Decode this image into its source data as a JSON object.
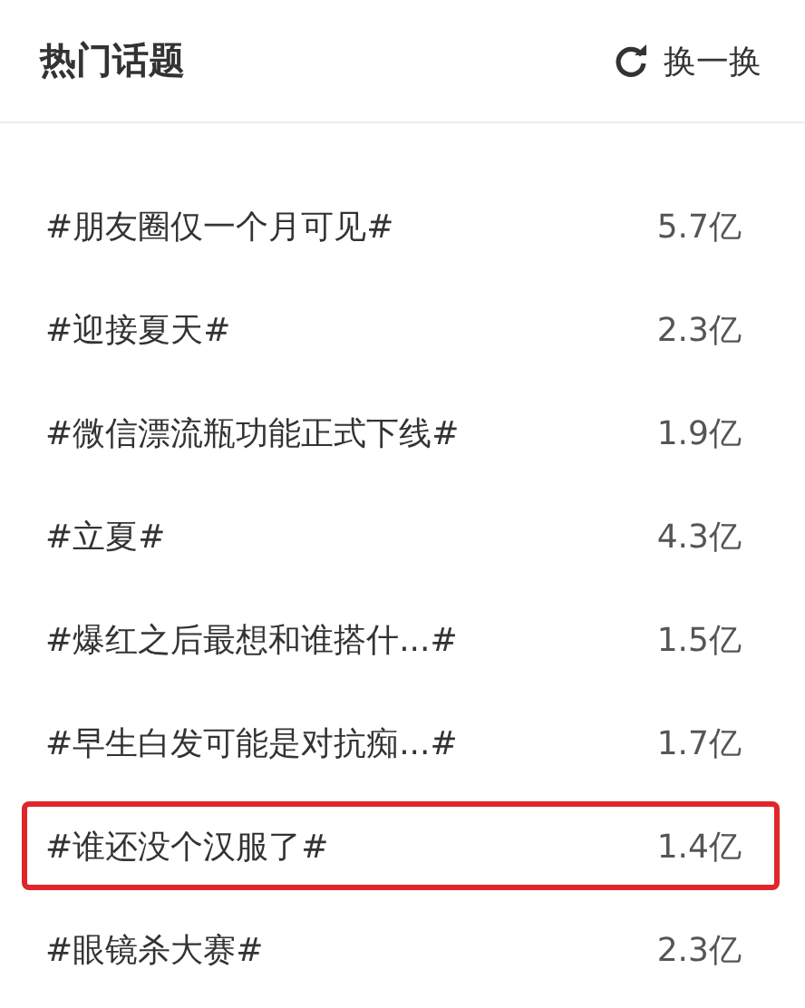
{
  "header": {
    "title": "热门话题",
    "refresh_label": "换一换"
  },
  "topics": [
    {
      "title": "#朋友圈仅一个月可见#",
      "count": "5.7亿",
      "highlighted": false
    },
    {
      "title": "#迎接夏天#",
      "count": "2.3亿",
      "highlighted": false
    },
    {
      "title": "#微信漂流瓶功能正式下线#",
      "count": "1.9亿",
      "highlighted": false
    },
    {
      "title": "#立夏#",
      "count": "4.3亿",
      "highlighted": false
    },
    {
      "title": "#爆红之后最想和谁搭什...#",
      "count": "1.5亿",
      "highlighted": false
    },
    {
      "title": "#早生白发可能是对抗痴...#",
      "count": "1.7亿",
      "highlighted": false
    },
    {
      "title": "#谁还没个汉服了#",
      "count": "1.4亿",
      "highlighted": true
    },
    {
      "title": "#眼镜杀大赛#",
      "count": "2.3亿",
      "highlighted": false
    }
  ]
}
